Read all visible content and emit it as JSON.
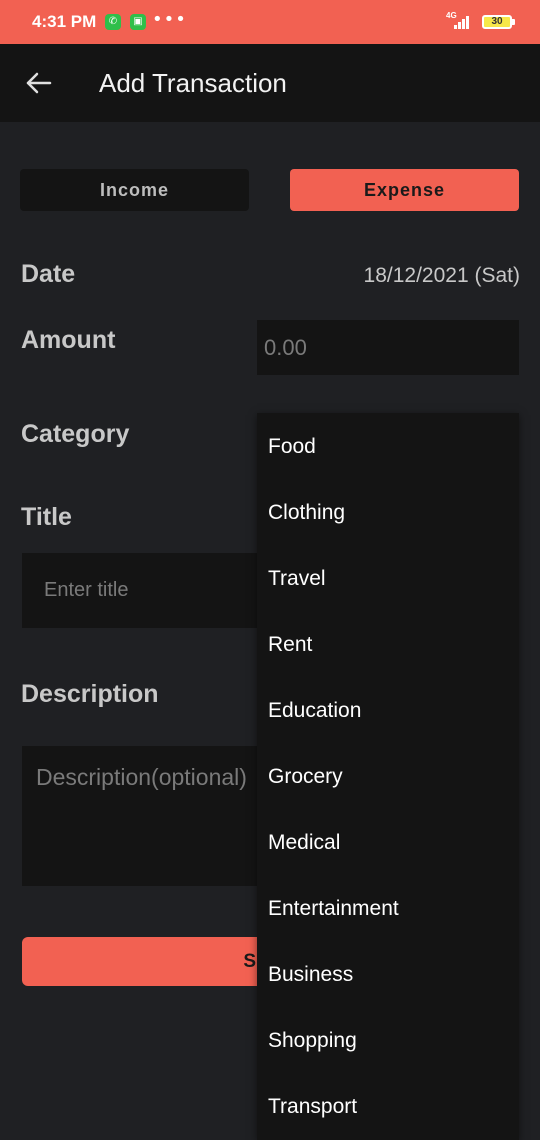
{
  "status_bar": {
    "time": "4:31 PM",
    "more": "•••",
    "network": "4G",
    "battery": "30",
    "icons": [
      "whatsapp-icon",
      "android-notification-icon",
      "signal-icon",
      "battery-icon"
    ],
    "color": "#f26152"
  },
  "app_bar": {
    "back_icon": "arrow-left-icon",
    "title": "Add Transaction"
  },
  "type_toggle": {
    "income_label": "Income",
    "expense_label": "Expense",
    "selected": "Expense"
  },
  "form": {
    "date_label": "Date",
    "date_value": "18/12/2021 (Sat)",
    "amount_label": "Amount",
    "amount_placeholder": "0.00",
    "category_label": "Category",
    "title_label": "Title",
    "title_placeholder": "Enter title",
    "description_label": "Description",
    "description_placeholder": "Description(optional)",
    "save_label": "SAVE"
  },
  "category_dropdown": {
    "items": [
      "Food",
      "Clothing",
      "Travel",
      "Rent",
      "Education",
      "Grocery",
      "Medical",
      "Entertainment",
      "Business",
      "Shopping",
      "Transport"
    ]
  },
  "colors": {
    "accent": "#f26152",
    "background": "#1f2023",
    "surface": "#141414",
    "text": "#c8c8c8"
  }
}
